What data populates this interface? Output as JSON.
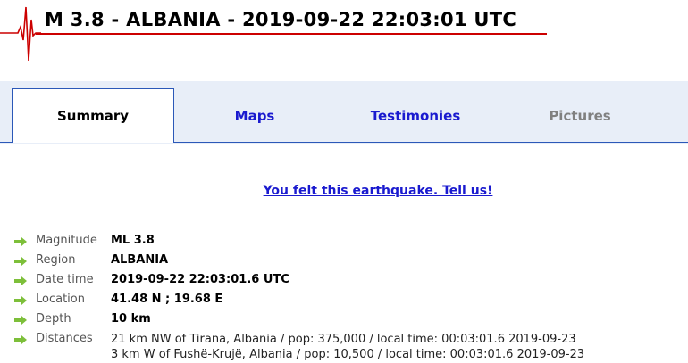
{
  "header": {
    "title": "M 3.8 - ALBANIA - 2019-09-22 22:03:01 UTC",
    "logo": "seismogram-icon",
    "accent_color": "#cc0000"
  },
  "tabs": [
    {
      "label": "Summary",
      "state": "active"
    },
    {
      "label": "Maps",
      "state": "link"
    },
    {
      "label": "Testimonies",
      "state": "link"
    },
    {
      "label": "Pictures",
      "state": "disabled"
    }
  ],
  "felt_link": "You felt this earthquake. Tell us!",
  "details": {
    "magnitude": {
      "label": "Magnitude",
      "value": "ML 3.8"
    },
    "region": {
      "label": "Region",
      "value": "ALBANIA"
    },
    "datetime": {
      "label": "Date time",
      "value": "2019-09-22 22:03:01.6 UTC"
    },
    "location": {
      "label": "Location",
      "value": "41.48 N ; 19.68 E"
    },
    "depth": {
      "label": "Depth",
      "value": "10 km"
    },
    "distances": {
      "label": "Distances",
      "lines": [
        "21 km NW of Tirana, Albania / pop: 375,000 / local time: 00:03:01.6 2019-09-23",
        "3 km W of Fushë-Krujë, Albania / pop: 10,500 / local time: 00:03:01.6 2019-09-23"
      ]
    }
  },
  "colors": {
    "link": "#1a1acf",
    "tab_bar": "#e8eef8",
    "tab_border": "#2b58b8",
    "arrow": "#7dbf3a"
  }
}
